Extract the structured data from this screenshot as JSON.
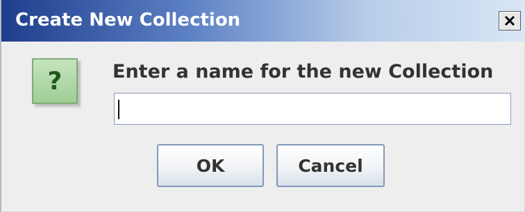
{
  "dialog": {
    "title": "Create New Collection",
    "close_label": "X",
    "prompt": "Enter a name for the new Collection",
    "question_mark": "?",
    "name_input": {
      "value": ""
    },
    "buttons": {
      "ok": "OK",
      "cancel": "Cancel"
    }
  },
  "icons": [
    "close-icon",
    "question-icon"
  ],
  "colors": {
    "title_gradient_start": "#1f3d8c",
    "title_gradient_end": "#d9e6f5",
    "icon_green": "#9fcd95",
    "button_border": "#7f99b8"
  }
}
